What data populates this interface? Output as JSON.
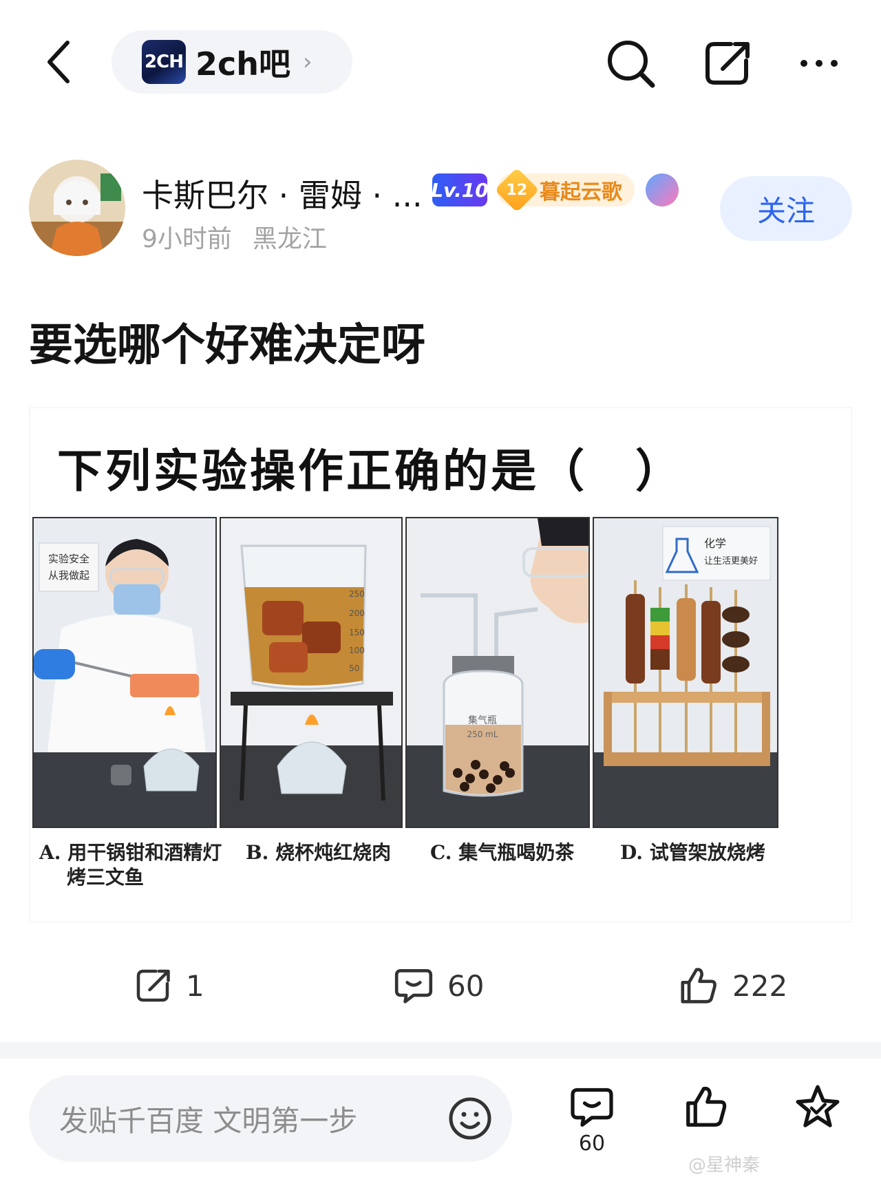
{
  "topbar": {
    "forum_logo_text": "2CH",
    "forum_name": "2ch吧",
    "icons": [
      "back-icon",
      "search-icon",
      "share-icon",
      "more-icon"
    ]
  },
  "author": {
    "name": "卡斯巴尔 · 雷姆 · ...",
    "level": "Lv.10",
    "guild_level": "12",
    "guild_name": "暮起云歌",
    "time": "9小时前",
    "location": "黑龙江",
    "follow_label": "关注"
  },
  "post": {
    "title": "要选哪个好难决定呀"
  },
  "quiz": {
    "question": "下列实验操作正确的是（　）",
    "options": [
      {
        "line1": "A. 用干锅钳和酒精灯",
        "line2": "烤三文鱼"
      },
      {
        "line1": "B. 烧杯炖红烧肉",
        "line2": ""
      },
      {
        "line1": "C. 集气瓶喝奶茶",
        "line2": ""
      },
      {
        "line1": "D. 试管架放烧烤",
        "line2": ""
      }
    ],
    "sign_a": [
      "实验安全",
      "从我做起"
    ],
    "beaker_marks": [
      "250",
      "200",
      "150",
      "100",
      "50"
    ],
    "bottle_label": [
      "集气瓶",
      "250 mL"
    ],
    "sign_d": [
      "化学",
      "让生活更美好"
    ]
  },
  "actions": {
    "share_count": "1",
    "comment_count": "60",
    "like_count": "222"
  },
  "bottombar": {
    "compose_placeholder": "发贴千百度 文明第一步",
    "comment_count": "60",
    "watermark": "@星神秦"
  },
  "colors": {
    "accent_blue": "#2c64f0",
    "follow_bg": "#e9f0ff",
    "guild_orange": "#e8891a"
  }
}
